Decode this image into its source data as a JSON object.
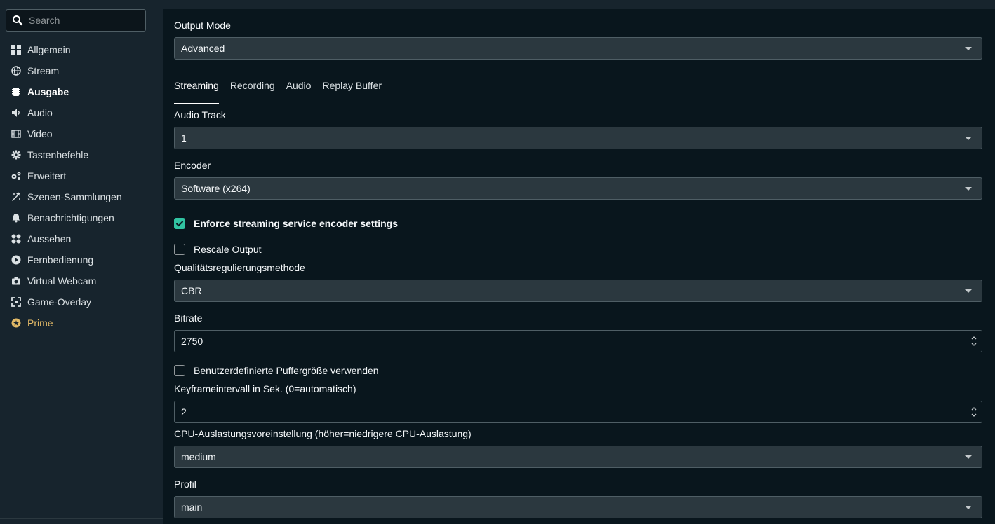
{
  "sidebar": {
    "search_placeholder": "Search",
    "items": [
      {
        "label": "Allgemein",
        "icon": "grid-icon"
      },
      {
        "label": "Stream",
        "icon": "globe-icon"
      },
      {
        "label": "Ausgabe",
        "icon": "chip-icon"
      },
      {
        "label": "Audio",
        "icon": "speaker-icon"
      },
      {
        "label": "Video",
        "icon": "film-icon"
      },
      {
        "label": "Tastenbefehle",
        "icon": "gear-icon"
      },
      {
        "label": "Erweitert",
        "icon": "gears-icon"
      },
      {
        "label": "Szenen-Sammlungen",
        "icon": "wand-icon"
      },
      {
        "label": "Benachrichtigungen",
        "icon": "bell-icon"
      },
      {
        "label": "Aussehen",
        "icon": "palette-icon"
      },
      {
        "label": "Fernbedienung",
        "icon": "play-circle-icon"
      },
      {
        "label": "Virtual Webcam",
        "icon": "camera-icon"
      },
      {
        "label": "Game-Overlay",
        "icon": "expand-icon"
      },
      {
        "label": "Prime",
        "icon": "prime-icon"
      }
    ],
    "active_index": 2
  },
  "output_mode": {
    "label": "Output Mode",
    "value": "Advanced"
  },
  "tabs": [
    "Streaming",
    "Recording",
    "Audio",
    "Replay Buffer"
  ],
  "active_tab": "Streaming",
  "audio_track": {
    "label": "Audio Track",
    "value": "1"
  },
  "encoder": {
    "label": "Encoder",
    "value": "Software (x264)"
  },
  "enforce": {
    "label": "Enforce streaming service encoder settings",
    "checked": true
  },
  "rescale": {
    "label": "Rescale Output",
    "checked": false
  },
  "rate_control": {
    "label": "Qualitätsregulierungsmethode",
    "value": "CBR"
  },
  "bitrate": {
    "label": "Bitrate",
    "value": "2750"
  },
  "custom_buffer": {
    "label": "Benutzerdefinierte Puffergröße verwenden",
    "checked": false
  },
  "keyframe": {
    "label": "Keyframeintervall in Sek. (0=automatisch)",
    "value": "2"
  },
  "cpu_preset": {
    "label": "CPU-Auslastungsvoreinstellung (höher=niedrigere CPU-Auslastung)",
    "value": "medium"
  },
  "profile": {
    "label": "Profil",
    "value": "main"
  },
  "colors": {
    "accent": "#31c3a2",
    "prime": "#e3ba67",
    "panel": "#09161d",
    "sidebar": "#17242d"
  }
}
